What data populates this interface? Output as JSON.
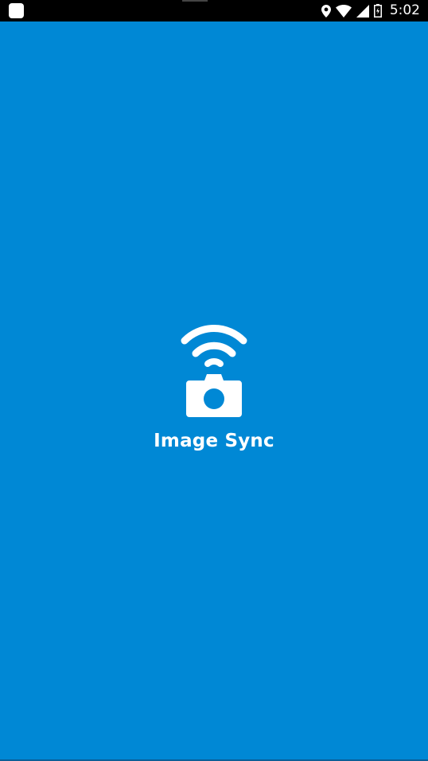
{
  "status_bar": {
    "time": "5:02",
    "icons": [
      "app-notification-icon",
      "location-icon",
      "wifi-icon",
      "cell-signal-icon",
      "battery-icon"
    ]
  },
  "splash": {
    "app_name": "Image Sync",
    "logo_icon": "wireless-camera-icon"
  },
  "colors": {
    "background": "#0088d5",
    "status_bar": "#000000",
    "foreground": "#ffffff"
  }
}
